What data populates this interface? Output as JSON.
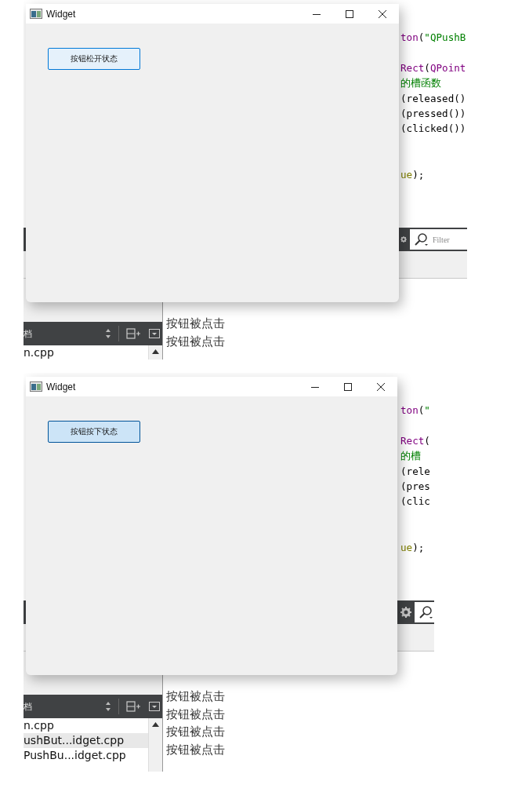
{
  "panels": [
    {
      "window": {
        "title": "Widget",
        "button": {
          "label": "按钮松开状态",
          "pressed": false
        }
      },
      "code_lines": [
        {
          "kind": "code",
          "segments": [
            {
              "text": "ton",
              "kind": "type"
            },
            {
              "text": "(",
              "kind": "plain"
            },
            {
              "text": "\"QPushB",
              "kind": "string"
            }
          ]
        },
        {
          "kind": "blank"
        },
        {
          "kind": "code",
          "segments": [
            {
              "text": "Rect",
              "kind": "type"
            },
            {
              "text": "(",
              "kind": "plain"
            },
            {
              "text": "QPoint",
              "kind": "type"
            }
          ]
        },
        {
          "kind": "code",
          "segments": [
            {
              "text": "的槽函数",
              "kind": "comment"
            }
          ]
        },
        {
          "kind": "code",
          "segments": [
            {
              "text": "(released()",
              "kind": "plain"
            }
          ]
        },
        {
          "kind": "code",
          "segments": [
            {
              "text": "(pressed())",
              "kind": "plain"
            }
          ]
        },
        {
          "kind": "code",
          "segments": [
            {
              "text": "(clicked())",
              "kind": "plain"
            }
          ]
        },
        {
          "kind": "blank"
        },
        {
          "kind": "blank"
        },
        {
          "kind": "code",
          "segments": [
            {
              "text": "ue",
              "kind": "keyword"
            },
            {
              "text": ");",
              "kind": "plain"
            }
          ]
        }
      ],
      "filter": {
        "kind": "field",
        "placeholder": "Filter"
      },
      "navigator": {
        "title": "档"
      },
      "files": [
        {
          "name": "n.cpp",
          "selected": false
        }
      ],
      "output_lines": [
        "按钮被点击",
        "按钮被点击"
      ]
    },
    {
      "window": {
        "title": "Widget",
        "button": {
          "label": "按钮按下状态",
          "pressed": true
        }
      },
      "code_lines": [
        {
          "kind": "code",
          "segments": [
            {
              "text": "ton",
              "kind": "type"
            },
            {
              "text": "(",
              "kind": "plain"
            },
            {
              "text": "\"",
              "kind": "string"
            }
          ]
        },
        {
          "kind": "blank"
        },
        {
          "kind": "code",
          "segments": [
            {
              "text": "Rect",
              "kind": "type"
            },
            {
              "text": "(",
              "kind": "plain"
            }
          ]
        },
        {
          "kind": "code",
          "segments": [
            {
              "text": "的槽",
              "kind": "comment"
            }
          ]
        },
        {
          "kind": "code",
          "segments": [
            {
              "text": "(rele",
              "kind": "plain"
            }
          ]
        },
        {
          "kind": "code",
          "segments": [
            {
              "text": "(pres",
              "kind": "plain"
            }
          ]
        },
        {
          "kind": "code",
          "segments": [
            {
              "text": "(clic",
              "kind": "plain"
            }
          ]
        },
        {
          "kind": "blank"
        },
        {
          "kind": "blank"
        },
        {
          "kind": "code",
          "segments": [
            {
              "text": "ue",
              "kind": "keyword"
            },
            {
              "text": ");",
              "kind": "plain"
            }
          ]
        }
      ],
      "filter": {
        "kind": "field"
      },
      "navigator": {
        "title": "档"
      },
      "files": [
        {
          "name": "n.cpp",
          "selected": false
        },
        {
          "name": "ushBut...idget.cpp",
          "selected": true
        },
        {
          "name": "PushBu...idget.cpp",
          "selected": false
        }
      ],
      "output_lines": [
        "按钮被点击",
        "按钮被点击",
        "按钮被点击",
        "按钮被点击"
      ]
    }
  ]
}
